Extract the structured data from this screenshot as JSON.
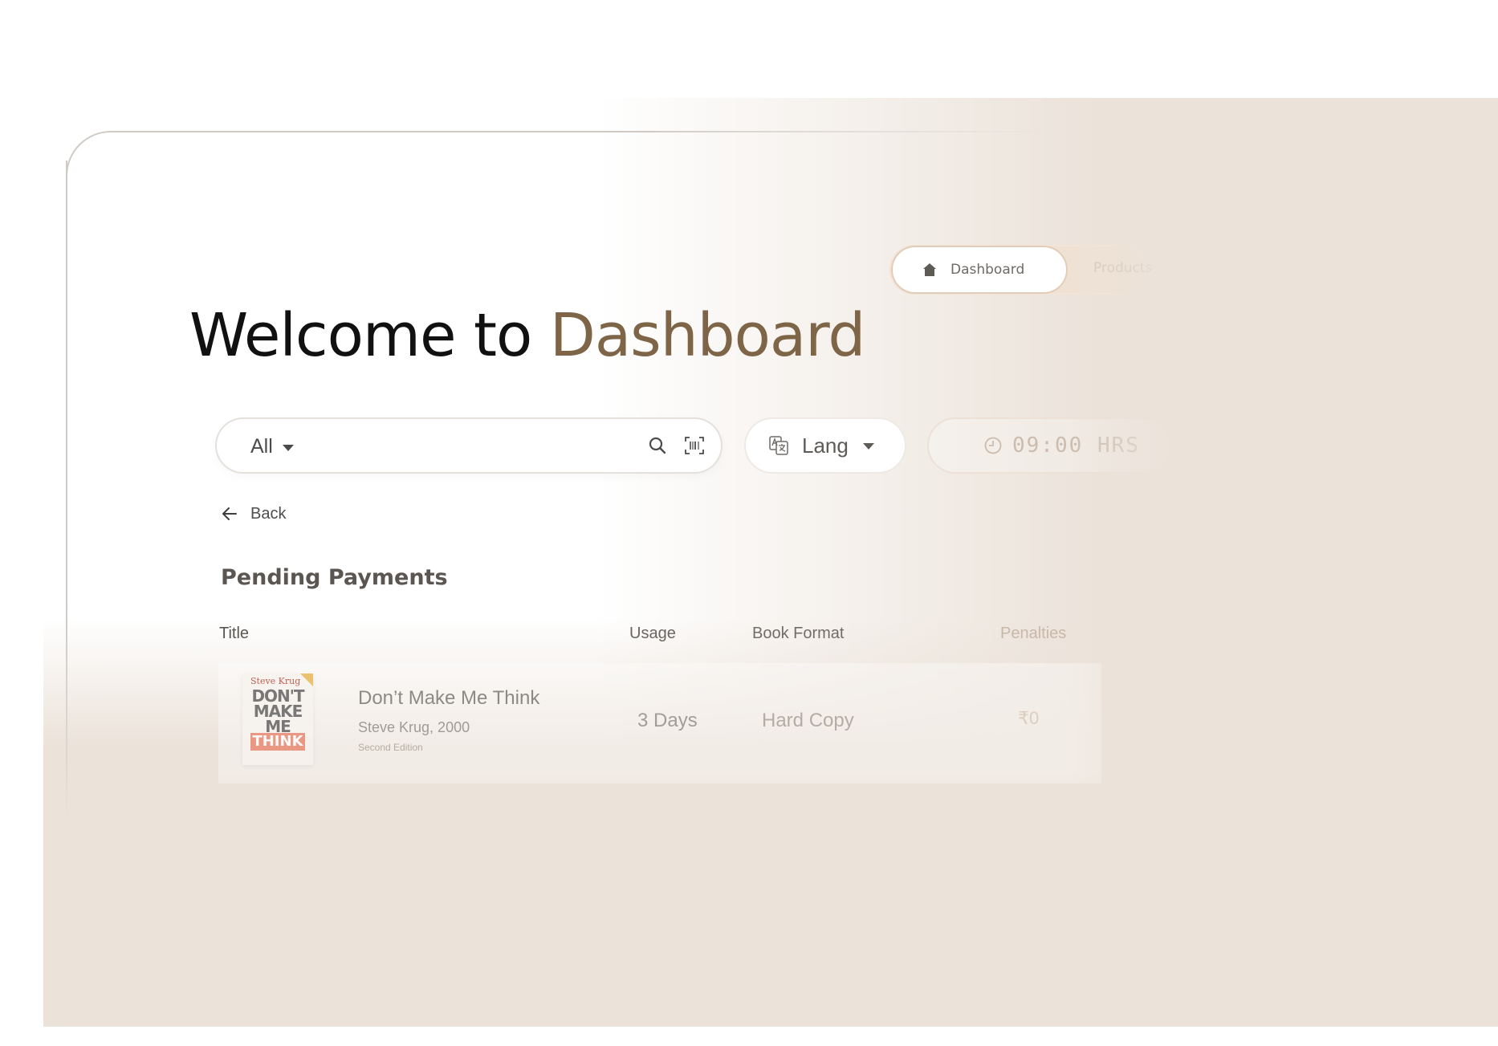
{
  "nav": {
    "items": [
      {
        "label": "Dashboard",
        "icon": "home-icon",
        "active": true
      },
      {
        "label": "Products",
        "active": false
      }
    ]
  },
  "heading": {
    "prefix": "Welcome to",
    "accent": "Dashboard",
    "accent_color": "#7e6547"
  },
  "search": {
    "filter_value": "All",
    "placeholder": "",
    "icons": [
      "search-icon",
      "barcode-scan-icon"
    ]
  },
  "language": {
    "label": "Lang",
    "icon": "translate-icon"
  },
  "clock": {
    "time": "09:00",
    "unit": "HRS",
    "icon": "clock-icon"
  },
  "back": {
    "label": "Back",
    "icon": "arrow-left-icon"
  },
  "section": {
    "title": "Pending Payments"
  },
  "table": {
    "columns": [
      "Title",
      "Usage",
      "Book Format",
      "Penalties"
    ],
    "rows": [
      {
        "title": "Don’t Make Me Think",
        "author_year": "Steve Krug, 2000",
        "edition": "Second Edition",
        "usage": "3 Days",
        "format": "Hard Copy",
        "penalty": "₹0",
        "cover": {
          "author": "Steve Krug",
          "lines": [
            "DON'T",
            "MAKE",
            "ME",
            "THINK"
          ]
        }
      }
    ]
  },
  "colors": {
    "background": "#ebe2d9",
    "accent": "#7e6547",
    "nav_active_border": "#e3cdb9"
  }
}
